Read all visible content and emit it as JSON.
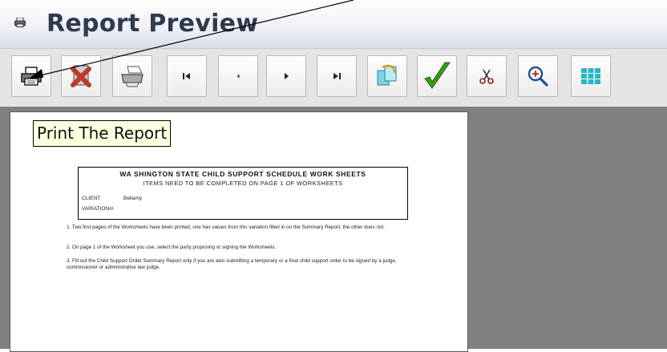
{
  "window": {
    "title": "Report Preview",
    "icon": "printer-icon"
  },
  "toolbar": {
    "buttons": [
      {
        "name": "print-button",
        "icon": "printer-icon"
      },
      {
        "name": "close-report-button",
        "icon": "red-x-icon"
      },
      {
        "name": "print-setup-button",
        "icon": "printer-setup-icon"
      },
      {
        "name": "first-page-button",
        "icon": "first-page-icon"
      },
      {
        "name": "previous-page-button",
        "icon": "previous-page-icon"
      },
      {
        "name": "next-page-button",
        "icon": "next-page-icon"
      },
      {
        "name": "last-page-button",
        "icon": "last-page-icon"
      },
      {
        "name": "export-button",
        "icon": "export-icon"
      },
      {
        "name": "approve-button",
        "icon": "green-check-icon"
      },
      {
        "name": "cut-button",
        "icon": "scissors-icon"
      },
      {
        "name": "zoom-button",
        "icon": "magnifier-plus-icon"
      },
      {
        "name": "multiple-pages-button",
        "icon": "grid-icon"
      }
    ]
  },
  "tooltip": {
    "text": "Print The Report"
  },
  "report": {
    "header_title": "WA SHINGTON STATE CHILD SUPPORT SCHEDULE WORK SHEETS",
    "header_subtitle": "ITEMS NEED TO BE COMPLETED ON PAGE 1 OF WORKSHEETS",
    "client_label": "CLIENT",
    "client_value": "Bellamy",
    "variation_label": "VARIATION/#",
    "instructions": [
      "1. Two first pages of the Worksheets have been printed, one has values from this variation filled in on the Summary Report, the other does not.",
      "2. On page 1 of the Worksheet you use, select the party proposing or signing the Worksheets.",
      "3. Fill out the Child Support Order Summary Report only if you are also submitting a temporary or a final child support order to be signed by a judge, commissioner or administrative law judge."
    ]
  },
  "colors": {
    "workspace": "#808080",
    "toolbar": "#e4e4e4",
    "tooltip_bg": "#ffffe1",
    "title_text": "#2f3a4f",
    "delete_red": "#c0392b",
    "check_green": "#3a9a1a",
    "grid_teal": "#28b8c8"
  }
}
